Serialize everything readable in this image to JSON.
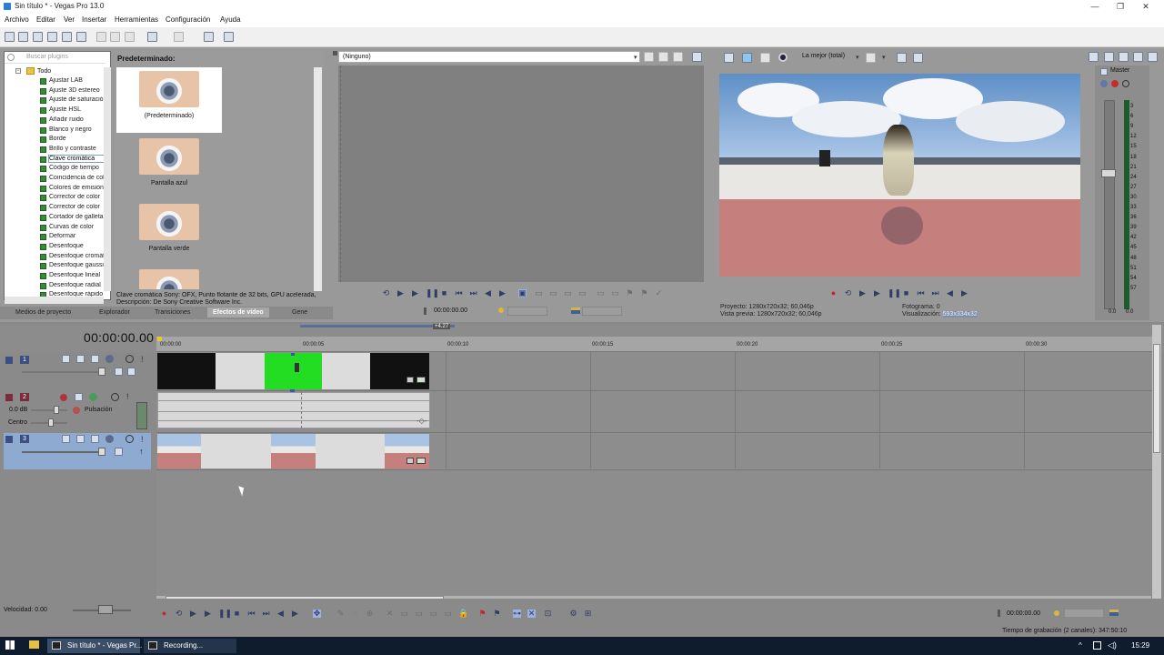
{
  "window": {
    "title": "Sin título * - Vegas Pro 13.0"
  },
  "menu": [
    "Archivo",
    "Editar",
    "Ver",
    "Insertar",
    "Herramientas",
    "Configuración",
    "Ayuda"
  ],
  "plugins": {
    "search_placeholder": "Buscar plugins",
    "root": "Todo",
    "items": [
      "Ajustar LAB",
      "Ajuste 3D estereo",
      "Ajuste de saturación",
      "Ajuste HSL",
      "Añadir ruido",
      "Blanco y negro",
      "Borde",
      "Brillo y contraste",
      "Clave cromática",
      "Código de tiempo",
      "Coincidencia de color",
      "Colores de emisión",
      "Corrector de color",
      "Corrector de color",
      "Cortador de galleta",
      "Curvas de color",
      "Deformar",
      "Desenfoque",
      "Desenfoque cromático",
      "Desenfoque gaussiano",
      "Desenfoque lineal",
      "Desenfoque radial",
      "Desenfoque rápido"
    ],
    "selected_index": 8
  },
  "presets": {
    "header": "Predeterminado:",
    "items": [
      "(Predeterminado)",
      "Pantalla azul",
      "Pantalla verde"
    ],
    "description_line1": "Clave cromática Sony: OFX, Punto flotante de 32 bits, GPU acelerada,",
    "description_line2": "Descripción: De Sony Creative Software Inc."
  },
  "left_tabs": [
    "Medios de proyecto",
    "Explorador",
    "Transiciones",
    "Efectos de vídeo",
    "Gene"
  ],
  "trimmer": {
    "selector": "(Ninguno)",
    "timecode": "00:00:00.00"
  },
  "preview": {
    "quality": "La mejor (total)",
    "project_label": "Proyecto:",
    "project_value": "1280x720x32; 60,046p",
    "vista_label": "Vista previa:",
    "vista_value": "1280x720x32; 60,046p",
    "frame_label": "Fotograma:",
    "frame_value": "0",
    "display_label": "Visualización:",
    "display_value": "593x334x32"
  },
  "master": {
    "label": "Master",
    "scale": [
      "3",
      "6",
      "9",
      "12",
      "15",
      "18",
      "21",
      "24",
      "27",
      "30",
      "33",
      "36",
      "39",
      "42",
      "45",
      "48",
      "51",
      "54",
      "57"
    ],
    "bottom_left": "0.0",
    "bottom_right": "0.0"
  },
  "timeline": {
    "clock": "00:00:00.00",
    "loop_marker": "+4.27",
    "ticks": [
      "00:00:00",
      "00:00:05",
      "00:00:10",
      "00:00:15",
      "00:00:20",
      "00:00:25",
      "00:00:30"
    ],
    "tracks": [
      {
        "num": "1",
        "type": "video"
      },
      {
        "num": "2",
        "type": "audio",
        "volume": "0.0 dB",
        "fx": "Pulsación",
        "pan": "Centro"
      },
      {
        "num": "3",
        "type": "video"
      }
    ]
  },
  "footer": {
    "rate": "Velocidad: 0.00",
    "timecode": "00:00:00.00",
    "record_time": "Tiempo de grabación (2 canales): 347:50:10"
  },
  "taskbar": {
    "tasks": [
      "Sin título * - Vegas Pr...",
      "Recording..."
    ],
    "clock": "15:29"
  },
  "colors": {
    "accent": "#2f3c63",
    "green_clip": "#22dd22",
    "selected_track": "#8eaad0"
  }
}
